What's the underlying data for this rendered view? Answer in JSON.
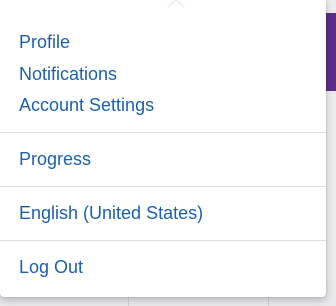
{
  "menu": {
    "groups": [
      {
        "items": [
          "Profile",
          "Notifications",
          "Account Settings"
        ]
      },
      {
        "items": [
          "Progress"
        ]
      },
      {
        "items": [
          "English (United States)"
        ]
      },
      {
        "items": [
          "Log Out"
        ]
      }
    ]
  },
  "colors": {
    "link": "#1b60b3",
    "divider": "#dedede",
    "accent": "#5a2d8a"
  }
}
